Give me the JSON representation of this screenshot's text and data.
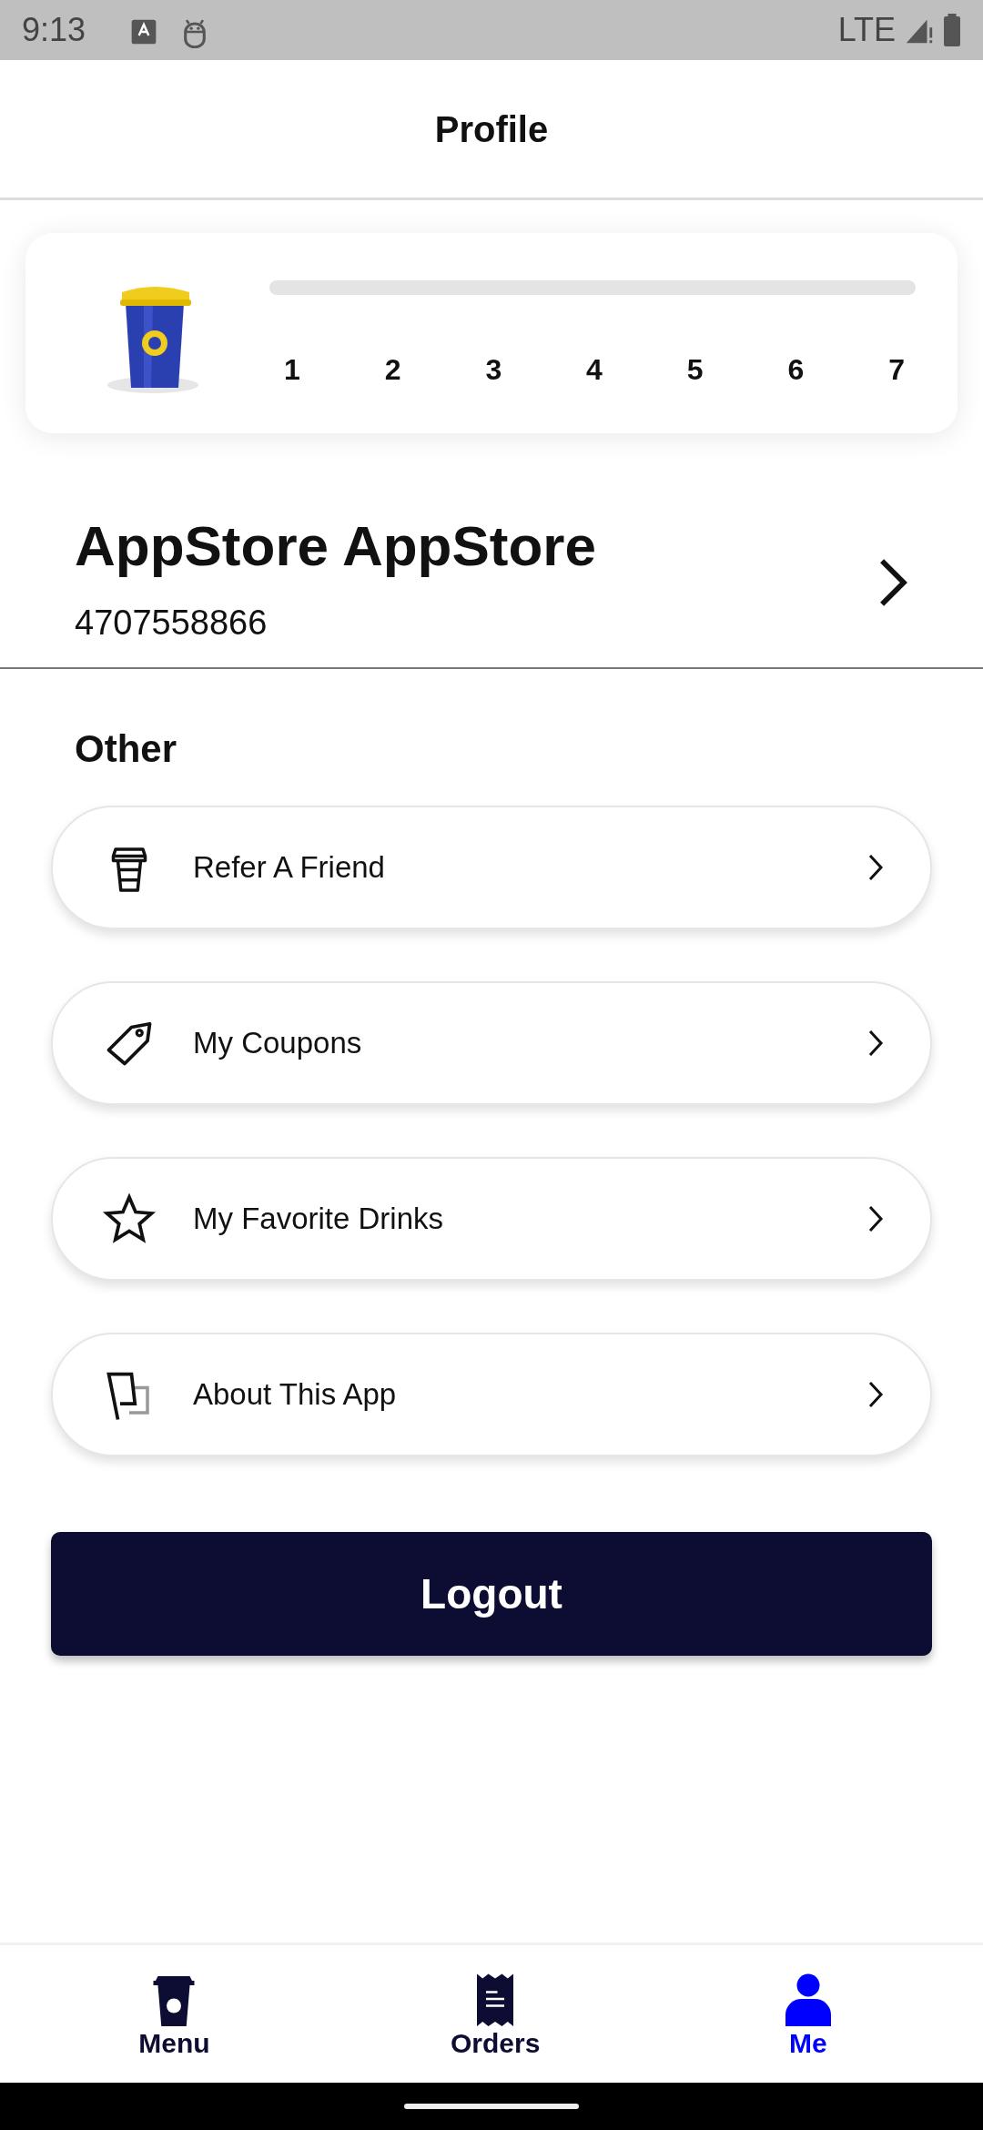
{
  "status_bar": {
    "time": "9:13",
    "network": "LTE"
  },
  "header": {
    "title": "Profile"
  },
  "loyalty_card": {
    "level": 0,
    "steps": [
      "1",
      "2",
      "3",
      "4",
      "5",
      "6",
      "7"
    ]
  },
  "profile": {
    "name": "AppStore AppStore",
    "phone": "4707558866"
  },
  "section_title": "Other",
  "menu_items": [
    {
      "label": "Refer A Friend"
    },
    {
      "label": "My Coupons"
    },
    {
      "label": "My Favorite Drinks"
    },
    {
      "label": "About This App"
    }
  ],
  "logout_button": "Logout",
  "bottom_nav": [
    {
      "label": "Menu",
      "selected": false
    },
    {
      "label": "Orders",
      "selected": false
    },
    {
      "label": "Me",
      "selected": true
    }
  ]
}
